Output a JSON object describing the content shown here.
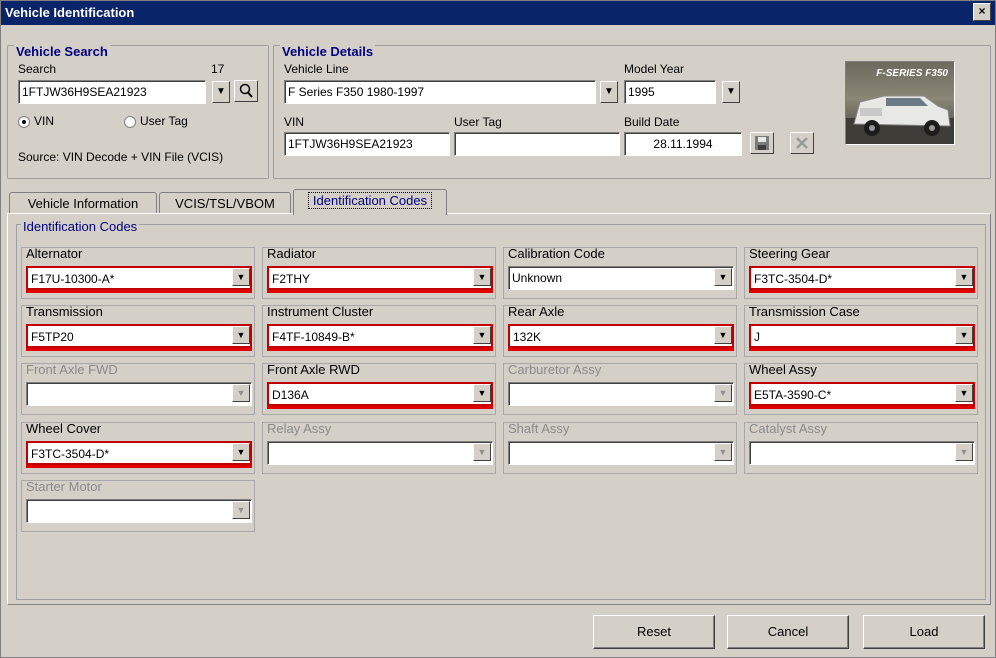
{
  "window": {
    "title": "Vehicle Identification",
    "close_glyph": "×"
  },
  "vehicle_search": {
    "title": "Vehicle Search",
    "search_label": "Search",
    "char_count": "17",
    "search_value": "1FTJW36H9SEA21923",
    "radio_vin_label": "VIN",
    "radio_usertag_label": "User Tag",
    "selected": "VIN",
    "source_text": "Source: VIN Decode + VIN File (VCIS)",
    "search_icon": "magnifier-icon"
  },
  "vehicle_details": {
    "title": "Vehicle Details",
    "vehicle_line_label": "Vehicle Line",
    "vehicle_line_value": "F Series F350 1980-1997",
    "model_year_label": "Model Year",
    "model_year_value": "1995",
    "vin_label": "VIN",
    "vin_value": "1FTJW36H9SEA21923",
    "user_tag_label": "User Tag",
    "user_tag_value": "",
    "build_date_label": "Build Date",
    "build_date_value": "28.11.1994",
    "thumbnail_text": "F-SERIES F350"
  },
  "tabs": [
    {
      "label": "Vehicle Information",
      "active": false
    },
    {
      "label": "VCIS/TSL/VBOM",
      "active": false
    },
    {
      "label": "Identification Codes",
      "active": true
    }
  ],
  "identification_codes": {
    "title": "Identification Codes",
    "fields": [
      {
        "label": "Alternator",
        "value": "F17U-10300-A*",
        "enabled": true,
        "required": true
      },
      {
        "label": "Radiator",
        "value": "F2THY",
        "enabled": true,
        "required": true
      },
      {
        "label": "Calibration Code",
        "value": "Unknown",
        "enabled": true,
        "required": false
      },
      {
        "label": "Steering Gear",
        "value": "F3TC-3504-D*",
        "enabled": true,
        "required": true
      },
      {
        "label": "Transmission",
        "value": "F5TP20",
        "enabled": true,
        "required": true
      },
      {
        "label": "Instrument Cluster",
        "value": "F4TF-10849-B*",
        "enabled": true,
        "required": true
      },
      {
        "label": "Rear Axle",
        "value": "132K",
        "enabled": true,
        "required": true
      },
      {
        "label": "Transmission Case",
        "value": "J",
        "enabled": true,
        "required": true
      },
      {
        "label": "Front Axle FWD",
        "value": "",
        "enabled": false,
        "required": false
      },
      {
        "label": "Front Axle RWD",
        "value": "D136A",
        "enabled": true,
        "required": true
      },
      {
        "label": "Carburetor Assy",
        "value": "",
        "enabled": false,
        "required": false
      },
      {
        "label": "Wheel Assy",
        "value": "E5TA-3590-C*",
        "enabled": true,
        "required": true
      },
      {
        "label": "Wheel Cover",
        "value": "F3TC-3504-D*",
        "enabled": true,
        "required": true
      },
      {
        "label": "Relay Assy",
        "value": "",
        "enabled": false,
        "required": false
      },
      {
        "label": "Shaft Assy",
        "value": "",
        "enabled": false,
        "required": false
      },
      {
        "label": "Catalyst Assy",
        "value": "",
        "enabled": false,
        "required": false
      },
      {
        "label": "Starter Motor",
        "value": "",
        "enabled": false,
        "required": false
      }
    ]
  },
  "buttons": {
    "reset": "Reset",
    "cancel": "Cancel",
    "load": "Load"
  },
  "colors": {
    "titlebar": "#0a246a",
    "group_title": "#000080",
    "required_border": "#c00000",
    "background": "#d4d0c8"
  }
}
